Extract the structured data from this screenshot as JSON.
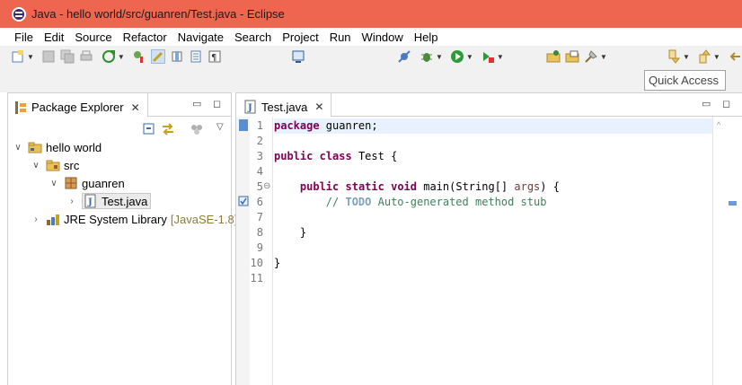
{
  "window": {
    "title": "Java - hello world/src/guanren/Test.java - Eclipse"
  },
  "menu": [
    "File",
    "Edit",
    "Source",
    "Refactor",
    "Navigate",
    "Search",
    "Project",
    "Run",
    "Window",
    "Help"
  ],
  "toolbar": {
    "quick_access_placeholder": "Quick Access"
  },
  "package_explorer": {
    "tab_label": "Package Explorer",
    "tree": {
      "project": "hello world",
      "src": "src",
      "package": "guanren",
      "file": "Test.java",
      "library": "JRE System Library",
      "library_decoration": "[JavaSE-1.8]"
    }
  },
  "editor": {
    "tab_label": "Test.java",
    "line_numbers": [
      "1",
      "2",
      "3",
      "4",
      "5",
      "6",
      "7",
      "8",
      "9",
      "10",
      "11"
    ],
    "code": {
      "l1_kw": "package",
      "l1_rest": " guanren;",
      "l3_kw1": "public",
      "l3_kw2": "class",
      "l3_rest": " Test {",
      "l5_kw1": "public",
      "l5_kw2": "static",
      "l5_kw3": "void",
      "l5_rest1": " main(String[] ",
      "l5_var": "args",
      "l5_rest2": ") {",
      "l6_prefix": "// ",
      "l6_todo": "TODO",
      "l6_rest": " Auto-generated method stub",
      "l8": "}",
      "l10": "}"
    }
  },
  "colors": {
    "titlebar": "#ef6650",
    "keyword": "#7f0055",
    "comment": "#3f7f5f",
    "todo": "#7f9fbf",
    "current_line": "#e8f2fe"
  },
  "icons": [
    "eclipse-icon",
    "new-icon",
    "save-icon",
    "save-all-icon",
    "print-icon",
    "new-java-project-icon",
    "debug-icon",
    "run-icon",
    "external-tools-icon",
    "package-explorer-icon",
    "java-file-icon",
    "collapse-all-icon",
    "link-editor-icon",
    "view-menu-icon",
    "minimize-icon",
    "maximize-icon",
    "close-icon",
    "project-folder-icon",
    "source-folder-icon",
    "package-icon",
    "library-icon"
  ]
}
